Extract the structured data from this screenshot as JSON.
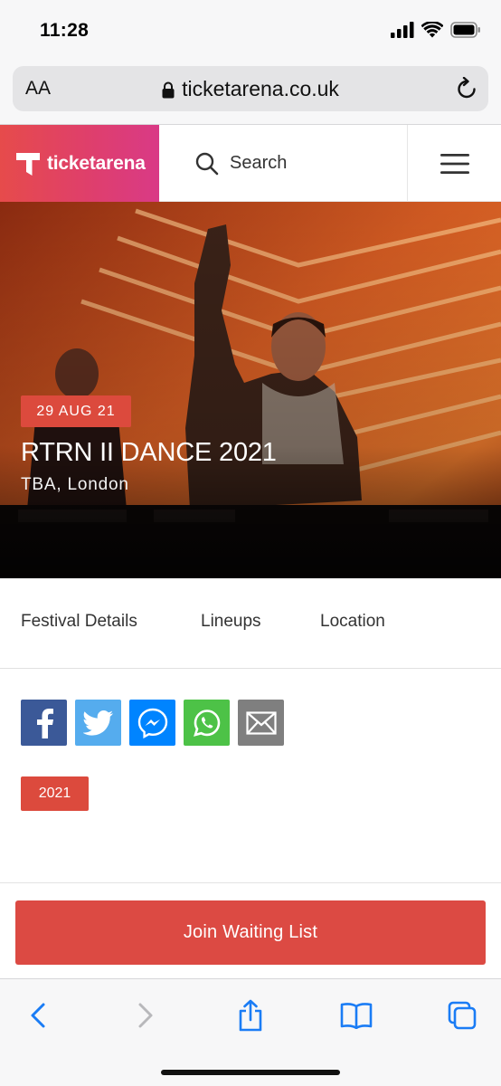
{
  "status_bar": {
    "time": "11:28"
  },
  "browser": {
    "aa_label": "AA",
    "url": "ticketarena.co.uk"
  },
  "site_header": {
    "logo_text": "ticketarena",
    "search_label": "Search"
  },
  "hero": {
    "date_badge": "29 AUG 21",
    "title": "RTRN II DANCE 2021",
    "venue": "TBA, London"
  },
  "tabs": [
    {
      "label": "Festival Details"
    },
    {
      "label": "Lineups"
    },
    {
      "label": "Location"
    }
  ],
  "share_buttons": [
    {
      "icon": "facebook-icon",
      "color": "#3b5998"
    },
    {
      "icon": "twitter-icon",
      "color": "#55acee"
    },
    {
      "icon": "messenger-icon",
      "color": "#0084ff"
    },
    {
      "icon": "whatsapp-icon",
      "color": "#4dc247"
    },
    {
      "icon": "email-icon",
      "color": "#7f7f7f"
    }
  ],
  "tag": "2021",
  "cta": {
    "label": "Join Waiting List"
  },
  "colors": {
    "accent": "#dc4a3d",
    "safari_blue": "#1a7cf5"
  }
}
